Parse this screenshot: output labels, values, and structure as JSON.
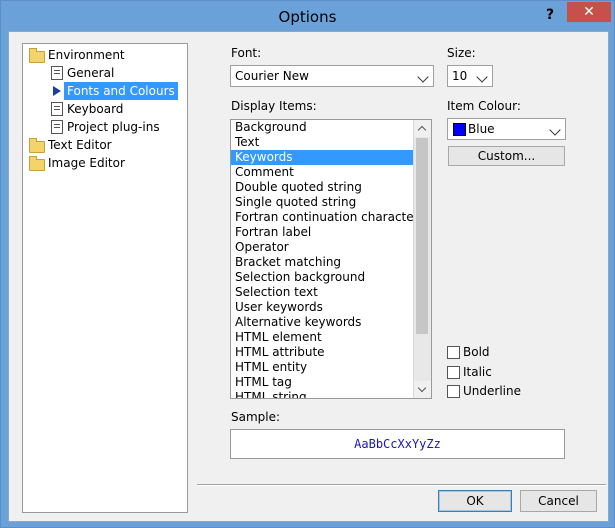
{
  "window": {
    "title": "Options",
    "help_glyph": "?",
    "close_glyph": "✕"
  },
  "tree": {
    "items": [
      {
        "label": "Environment"
      },
      {
        "label": "General"
      },
      {
        "label": "Fonts and Colours"
      },
      {
        "label": "Keyboard"
      },
      {
        "label": "Project plug-ins"
      },
      {
        "label": "Text Editor"
      },
      {
        "label": "Image Editor"
      }
    ]
  },
  "font": {
    "label": "Font:",
    "value": "Courier New"
  },
  "size": {
    "label": "Size:",
    "value": "10"
  },
  "display_items": {
    "label": "Display Items:",
    "items": [
      "Background",
      "Text",
      "Keywords",
      "Comment",
      "Double quoted string",
      "Single quoted string",
      "Fortran continuation character",
      "Fortran label",
      "Operator",
      "Bracket matching",
      "Selection background",
      "Selection text",
      "User keywords",
      "Alternative keywords",
      "HTML element",
      "HTML attribute",
      "HTML entity",
      "HTML tag",
      "HTML string"
    ],
    "selected": "Keywords"
  },
  "item_colour": {
    "label": "Item Colour:",
    "value": "Blue",
    "swatch": "#0000ff"
  },
  "custom_button": "Custom...",
  "styles": {
    "bold": "Bold",
    "italic": "Italic",
    "underline": "Underline"
  },
  "sample": {
    "label": "Sample:",
    "text": "AaBbCcXxYyZz"
  },
  "buttons": {
    "ok": "OK",
    "cancel": "Cancel"
  },
  "icons": {
    "tree_root": "folder-icon",
    "tree_leaf": "page-icon",
    "tree_selected": "arrow-icon",
    "dropdown": "chevron-down-icon"
  }
}
